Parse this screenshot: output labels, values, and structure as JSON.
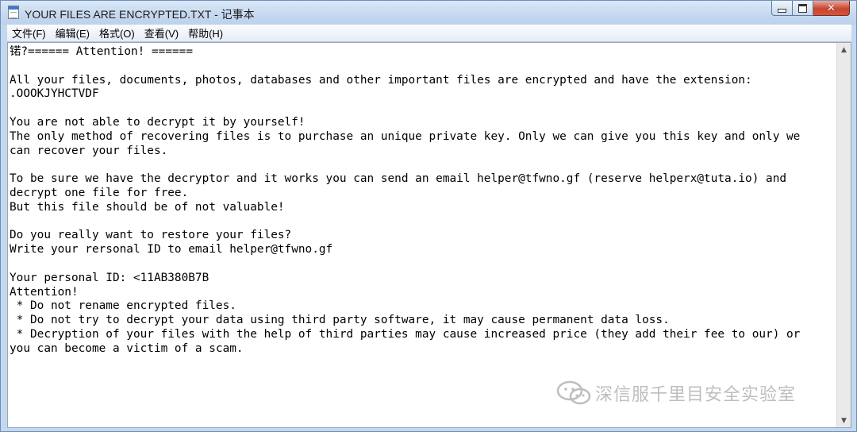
{
  "window": {
    "title": "YOUR FILES ARE ENCRYPTED.TXT - 记事本",
    "app_icon": "notepad-icon",
    "controls": {
      "minimize_icon": "minimize-icon",
      "maximize_icon": "maximize-icon",
      "close_icon": "close-icon",
      "close_glyph": "✕"
    }
  },
  "menu": [
    {
      "label": "文件(F)"
    },
    {
      "label": "编辑(E)"
    },
    {
      "label": "格式(O)"
    },
    {
      "label": "查看(V)"
    },
    {
      "label": "帮助(H)"
    }
  ],
  "document": {
    "text": "锘?====== Attention! ======\n\nAll your files, documents, photos, databases and other important files are encrypted and have the extension:\n.OOOKJYHCTVDF\n\nYou are not able to decrypt it by yourself!\nThe only method of recovering files is to purchase an unique private key. Only we can give you this key and only we\ncan recover your files.\n\nTo be sure we have the decryptor and it works you can send an email helper@tfwno.gf (reserve helperx@tuta.io) and\ndecrypt one file for free.\nBut this file should be of not valuable!\n\nDo you really want to restore your files?\nWrite your rersonal ID to email helper@tfwno.gf\n\nYour personal ID: <11AB380B7B\nAttention!\n * Do not rename encrypted files.\n * Do not try to decrypt your data using third party software, it may cause permanent data loss.\n * Decryption of your files with the help of third parties may cause increased price (they add their fee to our) or\nyou can become a victim of a scam."
  },
  "scrollbar": {
    "up_arrow": "▲",
    "down_arrow": "▼"
  },
  "watermark": {
    "text": "深信服千里目安全实验室",
    "icon": "wechat-icon"
  }
}
